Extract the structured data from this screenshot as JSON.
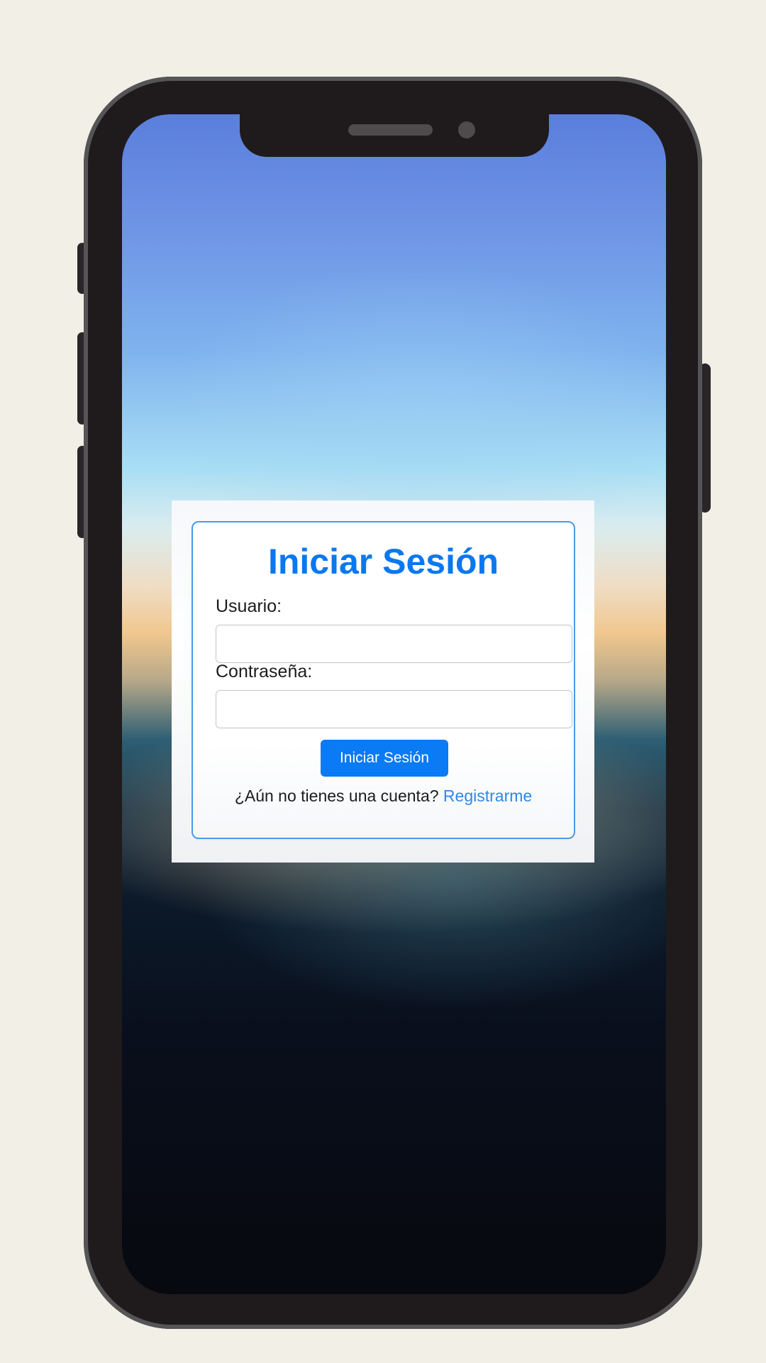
{
  "login": {
    "title": "Iniciar Sesión",
    "username_label": "Usuario:",
    "username_value": "",
    "password_label": "Contraseña:",
    "password_value": "",
    "submit_label": "Iniciar Sesión",
    "register_prompt": "¿Aún no tienes una cuenta?",
    "register_link": "Registrarme"
  },
  "colors": {
    "accent": "#0a78f0",
    "link": "#2d88e8",
    "card_border": "#4a9ae8",
    "page_background": "#f2efe6",
    "phone_frame": "#1f1b1c"
  }
}
